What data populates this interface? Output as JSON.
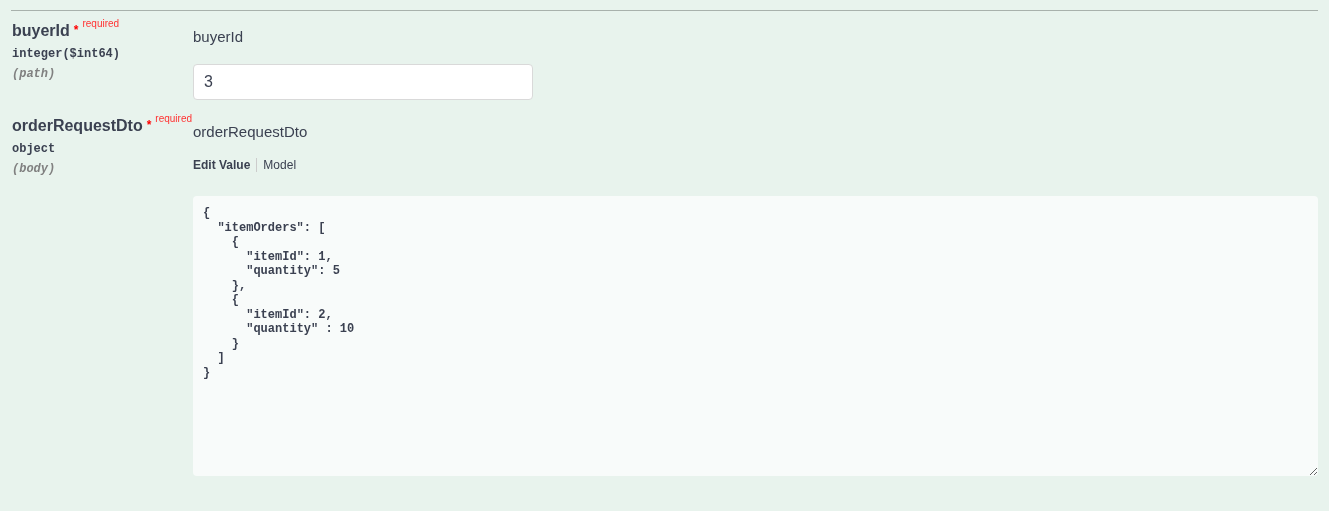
{
  "parameters": [
    {
      "kind": "input",
      "name": "buyerId",
      "required_mark": "*",
      "required_text": "required",
      "type": "integer($int64)",
      "location": "(path)",
      "label": "buyerId",
      "value": "3"
    },
    {
      "kind": "body",
      "name": "orderRequestDto",
      "required_mark": "*",
      "required_text": "required",
      "type": "object",
      "location": "(body)",
      "label": "orderRequestDto",
      "tabs": [
        {
          "label": "Edit Value",
          "selected": true
        },
        {
          "label": "Model",
          "selected": false
        }
      ],
      "value": "{\n  \"itemOrders\": [\n    {\n      \"itemId\": 1,\n      \"quantity\": 5\n    },\n    {\n      \"itemId\": 2,\n      \"quantity\" : 10\n    }\n  ]\n}"
    }
  ]
}
